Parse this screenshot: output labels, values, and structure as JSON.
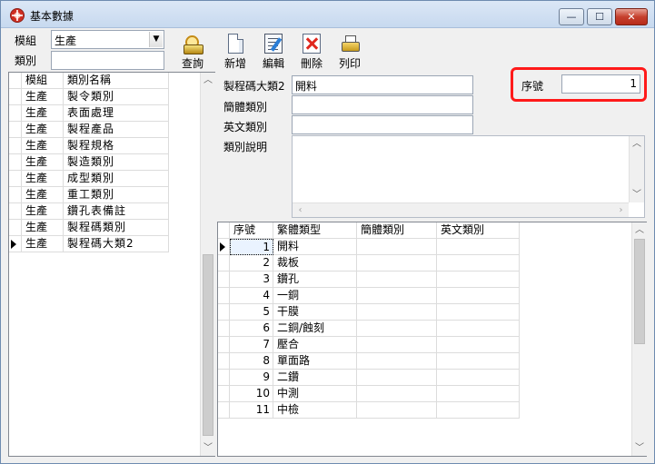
{
  "window": {
    "title": "基本數據",
    "min_glyph": "—",
    "max_glyph": "☐",
    "close_glyph": "✕"
  },
  "filter": {
    "module_label": "模組",
    "module_value": "生產",
    "category_label": "類別",
    "category_value": ""
  },
  "toolbar": {
    "query_label": "查詢",
    "new_label": "新增",
    "edit_label": "編輯",
    "delete_label": "刪除",
    "print_label": "列印"
  },
  "left_grid": {
    "headers": [
      "模組",
      "類別名稱"
    ],
    "rows": [
      [
        "生產",
        "製令類別"
      ],
      [
        "生產",
        "表面處理"
      ],
      [
        "生產",
        "製程產品"
      ],
      [
        "生產",
        "製程規格"
      ],
      [
        "生產",
        "製造類別"
      ],
      [
        "生產",
        "成型類別"
      ],
      [
        "生產",
        "重工類別"
      ],
      [
        "生產",
        "鑽孔表備註"
      ],
      [
        "生產",
        "製程碼類別"
      ],
      [
        "生產",
        "製程碼大類2"
      ]
    ],
    "selected_index": 9
  },
  "detail": {
    "trad_label": "製程碼大類2",
    "trad_value": "開料",
    "simp_label": "簡體類別",
    "simp_value": "",
    "eng_label": "英文類別",
    "eng_value": "",
    "desc_label": "類別說明",
    "desc_value": "",
    "seq_label": "序號",
    "seq_value": "1"
  },
  "right_grid": {
    "headers": [
      "序號",
      "繁體類型",
      "簡體類別",
      "英文類別"
    ],
    "rows": [
      [
        "1",
        "開料",
        "",
        ""
      ],
      [
        "2",
        "裁板",
        "",
        ""
      ],
      [
        "3",
        "鑽孔",
        "",
        ""
      ],
      [
        "4",
        "一銅",
        "",
        ""
      ],
      [
        "5",
        "干膜",
        "",
        ""
      ],
      [
        "6",
        "二銅/蝕刻",
        "",
        ""
      ],
      [
        "7",
        "壓合",
        "",
        ""
      ],
      [
        "8",
        "單面路",
        "",
        ""
      ],
      [
        "9",
        "二鑽",
        "",
        ""
      ],
      [
        "10",
        "中測",
        "",
        ""
      ],
      [
        "11",
        "中檢",
        "",
        ""
      ]
    ],
    "selected_index": 0
  },
  "colors": {
    "highlight": "#ff1a1a",
    "selected_cell": "#0078d7"
  }
}
